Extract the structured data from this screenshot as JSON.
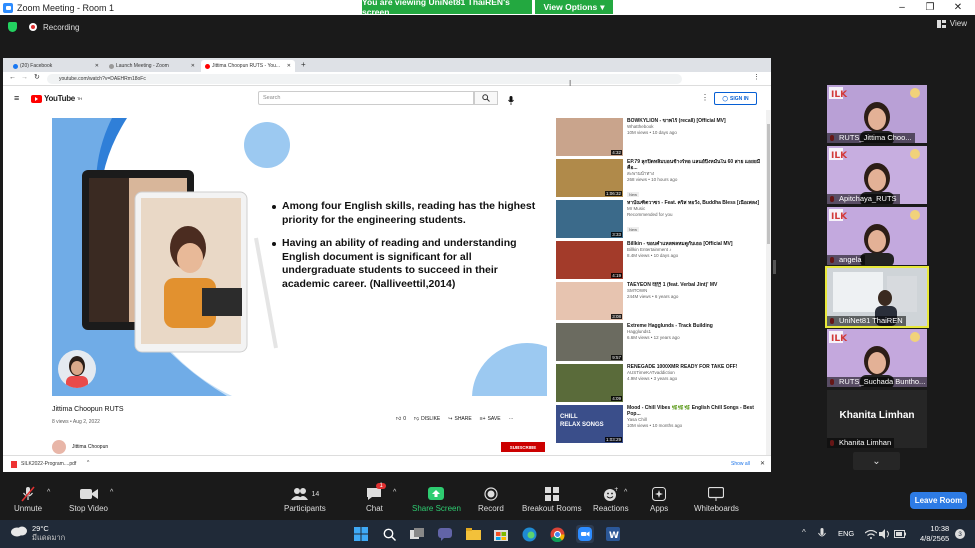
{
  "window": {
    "title": "Zoom Meeting - Room 1",
    "viewing_banner": "You are viewing UniNet81 ThaiREN's screen",
    "view_options_label": "View Options"
  },
  "recording": {
    "label": "Recording"
  },
  "view_label": "View",
  "browser": {
    "tabs": [
      {
        "label": "(20) Facebook",
        "color": "#1877f2"
      },
      {
        "label": "Launch Meeting - Zoom",
        "color": "#999999"
      },
      {
        "label": "Jittima Choopun RUTS - You...",
        "color": "#ff0000"
      }
    ],
    "address": "youtube.com/watch?v=DAEHRm18oFc"
  },
  "youtube": {
    "logo_text": "YouTube",
    "logo_sup": "TH",
    "search_placeholder": "Search",
    "sign_in": "SIGN IN",
    "slide_bullets": [
      "Among four English skills, reading has the highest priority for the engineering students.",
      "Having an ability of reading and understanding English document  is significant for all undergraduate students to succeed in their academic career. (Nalliveettil,2014)"
    ],
    "video_title": "Jittima Choopun RUTS",
    "video_meta": "8 views • Aug 2, 2022",
    "likes": "0",
    "dislike": "DISLIKE",
    "share": "SHARE",
    "save": "SAVE",
    "channel_name": "Jittima Choopun",
    "subscribe": "SUBSCRIBE",
    "recommendations": [
      {
        "title": "BOWKYLION - ขาพไร้ (recall) [Official MV]",
        "channel": "Whatthebook",
        "meta": "10M views • 10 days ago",
        "duration": "4:32",
        "badge": "",
        "thumb": "#c9a48c"
      },
      {
        "title": "EP.79 ลุกปิดหลิ่มบอนช้างร์ทอ แลนย์ปิ่งหมั่นใน 60 สาย แอยยมีคือ...",
        "channel": "สะพานนำทาง",
        "meta": "268 views • 10 hours ago",
        "duration": "1:06:32",
        "badge": "New",
        "thumb": "#b08a4a"
      },
      {
        "title": "หาบัณฑิตวาซร - Feat. คริส หอวัง, Buddha Bless [เนื้อเพลง]",
        "channel": "Mr Music",
        "meta": "Recommended for you",
        "duration": "3:33",
        "badge": "New",
        "thumb": "#3b6a8a"
      },
      {
        "title": "Billkin - ขอบคำแหลพลหมดูกับเธอ [Official MV]",
        "channel": "Billkin Entertainment ♪",
        "meta": "8.4M views • 10 days ago",
        "duration": "4:19",
        "badge": "",
        "thumb": "#a33b2a"
      },
      {
        "title": "TAEYEON 태연 1 (feat. Verbal Jint)' MV",
        "channel": "SMTOWN",
        "meta": "244M views • 6 years ago",
        "duration": "3:08",
        "badge": "",
        "thumb": "#e7c4b0"
      },
      {
        "title": "Extreme Hagglunds - Track Building",
        "channel": "Hagglunds1",
        "meta": "6.6M views • 12 years ago",
        "duration": "9:57",
        "badge": "",
        "thumb": "#6b6b60"
      },
      {
        "title": "RENEGADE 1000XMR READY FOR TAKE OFF!",
        "channel": "AUSTimeKATvaddiction",
        "meta": "4.9M views • 3 years ago",
        "duration": "4:09",
        "badge": "",
        "thumb": "#5a6b3a"
      },
      {
        "title": "Mood - Chill Vibes 🌿🌿🌿 English Chill Songs - Best Pop...",
        "channel": "Yasa Chill",
        "meta": "10M views • 10 months ago",
        "duration": "1:03:29",
        "badge": "",
        "thumb": "#3a4e8a",
        "overlay": "CHILL\nRELAX SONGS"
      }
    ]
  },
  "download": {
    "file": "SILK2022-Program....pdf",
    "show_all": "Show all"
  },
  "participants_tiles": [
    {
      "name": "RUTS_Jittima Choo...",
      "bg": "#b9a0d6"
    },
    {
      "name": "Apitchaya_RUTS",
      "bg": "#c7aee0"
    },
    {
      "name": "angela",
      "bg": "#c3a9de"
    },
    {
      "name": "UniNet81 ThaiREN",
      "bg": "#cfd4d8"
    },
    {
      "name": "RUTS_Suchada Buntho...",
      "bg": "#c4a8dd"
    },
    {
      "name": "Khanita Limhan",
      "bg": "#262626",
      "big_name": "Khanita Limhan"
    }
  ],
  "toolbar": {
    "unmute": "Unmute",
    "stop_video": "Stop Video",
    "participants": "Participants",
    "participants_count": "14",
    "chat": "Chat",
    "chat_badge": "1",
    "share_screen": "Share Screen",
    "record": "Record",
    "breakout": "Breakout Rooms",
    "reactions": "Reactions",
    "apps": "Apps",
    "whiteboards": "Whiteboards",
    "leave": "Leave Room"
  },
  "taskbar": {
    "temp": "29°C",
    "weather_text": "มีแดดมาก",
    "lang": "ENG",
    "time": "10:38",
    "date": "4/8/2565",
    "notif": "3"
  },
  "colors": {
    "zoom_green": "#23a840",
    "leave_blue": "#2d7be5",
    "yt_red": "#ff0000"
  }
}
